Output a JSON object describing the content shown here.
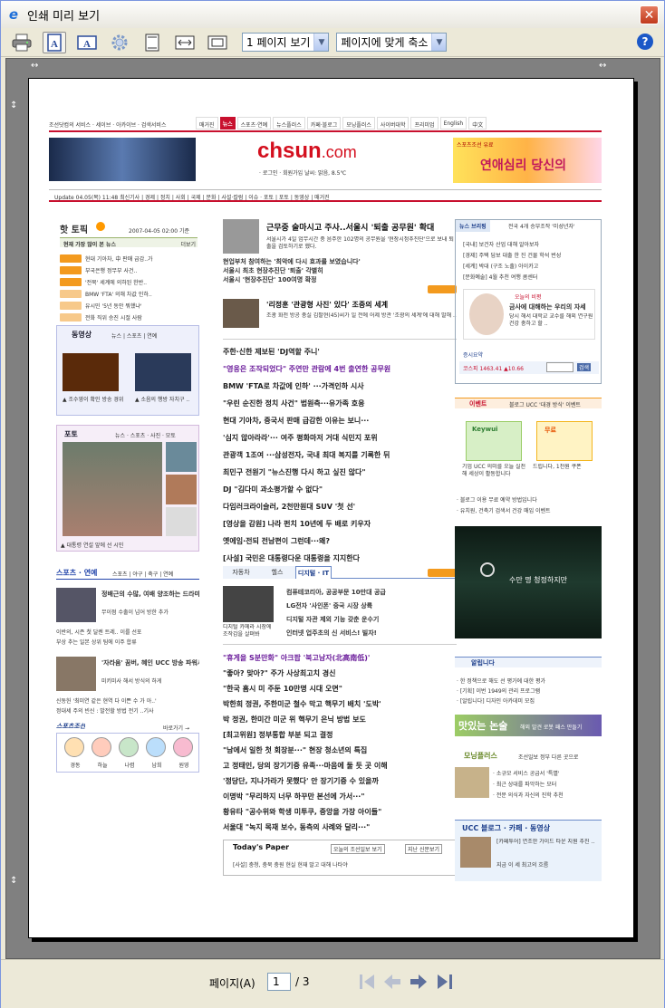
{
  "window": {
    "title": "인쇄 미리 보기",
    "close_glyph": "✕",
    "app_icon_glyph": "e"
  },
  "toolbar": {
    "buttons": [
      {
        "name": "print",
        "icon": "printer-icon"
      },
      {
        "name": "landscape",
        "icon": "portrait-page-icon"
      },
      {
        "name": "portrait",
        "icon": "landscape-page-icon"
      },
      {
        "name": "page-setup",
        "icon": "gear-icon"
      },
      {
        "name": "header-footer",
        "icon": "header-footer-icon"
      },
      {
        "name": "full-width",
        "icon": "full-width-icon"
      },
      {
        "name": "full-page",
        "icon": "full-page-icon"
      }
    ],
    "view_select": "1 페이지 보기",
    "zoom_select": "페이지에 맞게 축소",
    "help": "?"
  },
  "navigation": {
    "page_label": "페이지(A)",
    "current_page": "1",
    "total": "/ 3"
  },
  "preview": {
    "masthead_top": "조선닷컴의 서비스 · 세이브 · 아카이브 · 검색서비스",
    "top_tabs": [
      "매거진",
      "뉴스",
      "스포츠·연예",
      "뉴스플러스",
      "카페·블로그",
      "모닝플러스",
      "사이버대학",
      "프리미엄",
      "English",
      "中文"
    ],
    "logo_a": "ch",
    "logo_b": "sun",
    "logo_c": ".com",
    "login_line": "· 로그인 · 회원가입  날씨: 맑음, 8.5℃",
    "ad_right": "연애심리 당신의",
    "ad_right_top": "스포츠조선 유료",
    "nav_line": "Update 04.05(목) 11:48    최신기사 | 경제 | 정치 | 사회 | 국제 | 문화 | 사설·칼럼 | 이슈 · 포토 | 포토 | 동영상 | 매거진",
    "hot_title": "핫 토픽",
    "hot_time": "2007-04-05 02:00 기준",
    "hot_sub": "현재 가장 많이 본 뉴스",
    "hot_more": "더보기",
    "hot_items": [
      "현대 기아차, 中 판매 급감..가",
      "부국은행 정무부 사건..",
      "'전북' 세계에 의하된 한반..",
      "BMW 'FTA' 의해 차값 인하..",
      "유시민 '5년 동안 뭐했냐'",
      "전화 직위 승진 시절 사람"
    ],
    "video_title": "동영상",
    "video_tabs": "뉴스 | 스포츠 | 연예",
    "video_caps": [
      "▲ 조수영이 확인 방송 경위 ..",
      "▲ 소음의 행방 자치구 .."
    ],
    "photo_title": "포토",
    "photo_tabs": "뉴스 · 스포츠 · 사진 · 모토",
    "photo_cap": "▲ 대통령 연설 앞에 선 시민",
    "sports_title": "스포츠 · 연예",
    "sports_tabs": "스포츠 | 야구 | 축구 | 연예",
    "sports_item1": "정배근의 수많, 여배 양조하는 드라마..",
    "sports_item1b": "무이점 수출이 넘어 방한 추가",
    "sports_item2": "'자라움' 꿈버, 혜인 UCC 방송 파워서 최고 흥행",
    "sports_item2b": "미키미사 해서 방식의 하게",
    "sports_list": [
      "이반의, 시즌 첫 달렌 트레.. 이를 선포",
      "부상 추는 일본 상위 팀에 이주 합류",
      "신동헌 '최미연 같은 현역 다 이쁜 수 가 아..'",
      "정대세 주의 빈신 : 발전할 방법 전기 ..기사"
    ],
    "sports_logo": "스포츠조선",
    "sports_more": "바로가기 →",
    "avatars": [
      "경동",
      "하늘",
      "나렴",
      "남희",
      "원영"
    ],
    "headline": "근무중 술마시고 주사..서울시 '퇴출 공무원' 확대",
    "headline_sub": "서울시가 4일 업무시간 중 음주한 102명의 공무원을 '현장시정추진단'으로 보내 퇴출을 검토하기로 했다.",
    "center_lines": [
      "현업부처 참여하는 '최악에 다시 효과를 보였습니다'",
      "서울시 최초 현장추진단 '퇴출' 각별히",
      "서울시 '현장추진단' 100여명 확정"
    ],
    "second_head": "'리정훈 '관광형 사진' 있다' 조중의 세계",
    "second_sub": "조광 화천 방공 충실 김팔현(45)씨가 일 전에 어제 방관 '조광의 세계'에 대해 말해 ..",
    "news_list": [
      "주한·신한 제보된 'DJ역할 주니'",
      "\"영웅은 조작되었다\" 주연만 관람에 4번 출연한 공무원",
      "BMW 'FTA로 차값에 인하' ···가격인하 시사",
      "\"우린 순진한 정치 사건\" 법원측···유가족 호응",
      "현대 기아차, 중국서 판매 급감한 이유는 보니···",
      "'심지 않아라라'··· 여주 평화마저 거대 식민지 포위",
      "관광객 1조여 ···삼성전자, 국내 최대 복지를 기록한 뒤",
      "최민구 전원기 \"뉴스진행 다시 하고 싶진 않다\"",
      "DJ \"김다미 과소평가할 수 없다\"",
      "다임러크라이슬러, 2천만원대 SUV '첫 선'",
      "[영상을 감원] 나라 펀치 10년에 두 배로 키우자",
      "옛에임·전되 전남편이 그런데···왜?",
      "[사설] 국민은 대통령다운 대통령을 지지한다"
    ],
    "tabs_mid": [
      "자동차",
      "헬스",
      "디지털 · IT"
    ],
    "mid_more": "더보기",
    "it_lines": [
      "컴퓨테코리아, 공공부문 10만대 공급",
      "LG전자 '사인폰' 중국 시장 상륙",
      "디지털 자관 제외 기능 갖춘 운수기",
      "인터넷 업주초의 신 서비스! 빌자!"
    ],
    "it_cap": "디지털 카메라 시장에 조작감을 살펴봐",
    "news_list2": [
      "\"휴게을 S분만화\" 아크팝 '북고남자(北高南低)'",
      "\"좋아? 맞아?\" 주가 사상최고치 경신",
      "\"한국 홈시 미 주둔 10만명 시대 오면\"",
      "박한희 정권, 주한미군 철수 막고 핵무기 배치 '도박'",
      "박 정권, 한미간 미군 위 핵무기 은닉 방법 보도",
      "[최고위원] 정부통합 부분 되고 결정",
      "\"남에서 일한 첫 회장분···\" 현장 청소년의 특집",
      "고 정태인, 당의 장기기증 유족···마음에 둘 듯 곳 이해",
      "'정당단, 지나가라가 못했다' 안 장기기증 수 있을까",
      "이명박 \"무리하지 너무 하꾸만 본선에 가서···\"",
      "황유타 \"공수위와 학생 미투쿠, 중앙을 가장 아이들\"",
      "서울대 \"녹지 목재 보수, 동측의 사례와 달리···\""
    ],
    "todays_paper": "Today's Paper",
    "todays_paper_btn": "오늘의 조선일보 보기",
    "todays_btn2": "지난 신문보기",
    "todays_line": "[사설] 충청, 충북 충원 현실 현재 말고 대해 나타야",
    "right_tab": "뉴스 브리핑",
    "right_hdr_text": "전국 4개 승부조작 '미성년자'",
    "briefing": [
      "[국내] 보건자 산업 대해 알아보자",
      "[경제] 주택 담보 대출 한 진 건물 학석 번성",
      "[세계] 박대 (구조 노출) 아이카고",
      "[문화예술] 4월 추천 여행 콤센터"
    ],
    "column_title": "오늘의 비평",
    "column_text": "금사에 대해하는 우리의 자세",
    "column_sub": "당시 해서 대학교 교수를 해외 연구원 건강 충하고 할 ..",
    "stock_label": "증시요약",
    "kospi": "코스피 1463.41 ▲10.66",
    "search_btn": "검색",
    "event_title": "이벤트",
    "event_hdr": "블로그 UCC '대경 방식' 이벤트",
    "event1_logo": "Keywui",
    "event1_cap": "기업 UCC 의미를 오늘 실천해 세상이 활동합니다",
    "event2_badge": "무료",
    "event2_cap": "드립니다, 1천원 쿠폰",
    "event_lines": [
      "· 블로그 이용 무료 예약 방법입니다",
      "· 유치원, 건축기 검색서 건강 매입 이벤트"
    ],
    "ad_box_text": "수만 명 청정하지만",
    "market_title": "알립니다",
    "market_lines": [
      "· 한 정책으로 해도 선 평가에 대한 평가",
      "· [기획] 이번 1949의 관리 프로그램",
      "· [알립니다] 디자인 아카데미 모집"
    ],
    "banner_text": "맛있는 논술",
    "banner_sub": "해외 발견 로봇 패스 만들기",
    "morning_title": "모닝플러스",
    "morning_sub": "조선일보 정부 다른 곳으로",
    "morning_lines": [
      "· 소규모 서비스 공급서 '특별'",
      "· 최근 상대를 파악하는 모터",
      "· 전문 의식과 자신의 진학 추천"
    ],
    "ucc_title": "UCC 블로그 · 카페 · 동영상",
    "ucc_text": "[카페투어] 연조한 가이드 타운 지원 추진 ..",
    "ucc_text2": "지금 이 세 최고의 흐름"
  }
}
